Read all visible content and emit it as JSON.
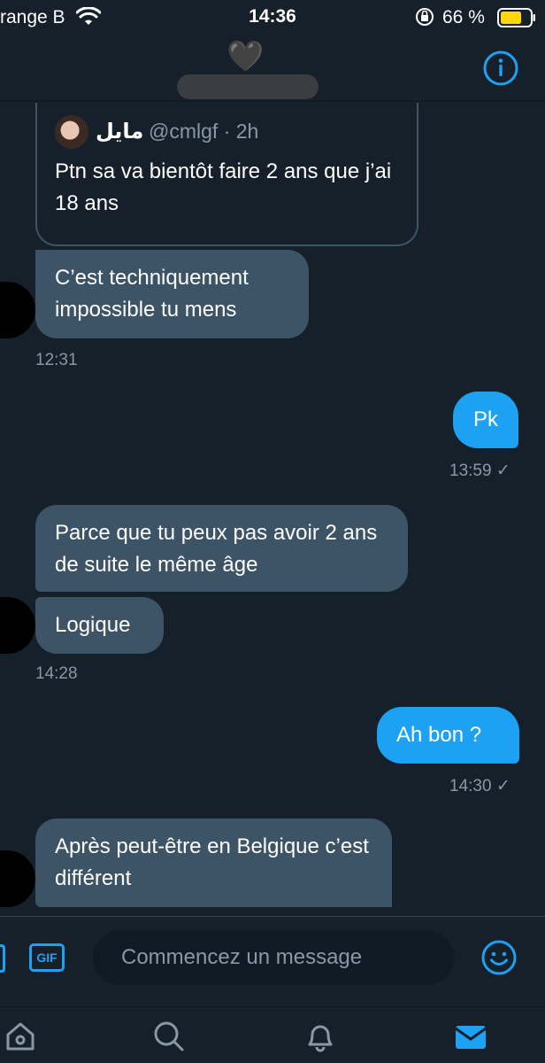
{
  "status_bar": {
    "carrier": "range B",
    "time": "14:36",
    "battery_percent": "66 %"
  },
  "header": {
    "emoji": "🖤",
    "name_redacted": true
  },
  "quoted_tweet": {
    "name": "مايل",
    "handle_time": "@cmlgf · 2h",
    "text": "Ptn sa va bientôt faire 2 ans que j’ai 18 ans"
  },
  "messages": [
    {
      "side": "in",
      "text": "C’est techniquement impossible tu mens"
    },
    {
      "side": "out",
      "text": "Pk"
    },
    {
      "side": "in",
      "text": "Parce que tu peux pas avoir 2 ans de suite le même âge"
    },
    {
      "side": "in",
      "text": "Logique"
    },
    {
      "side": "out",
      "text": "Ah  bon ?"
    },
    {
      "side": "in",
      "text": "Après peut-être en Belgique c’est différent"
    }
  ],
  "timestamps": {
    "t1": "12:31",
    "t2": "13:59 ✓",
    "t3": "14:28",
    "t4": "14:30 ✓"
  },
  "composer": {
    "gif_label": "GIF",
    "placeholder": "Commencez un message"
  },
  "icons": {
    "info": "info-icon",
    "emoji": "emoji-icon",
    "home": "home-icon",
    "search": "search-icon",
    "notifications": "bell-icon",
    "messages": "mail-icon"
  },
  "colors": {
    "background": "#15202b",
    "accent": "#1da1f2",
    "incoming_bubble": "#3d5466",
    "muted_text": "#8899a6"
  }
}
